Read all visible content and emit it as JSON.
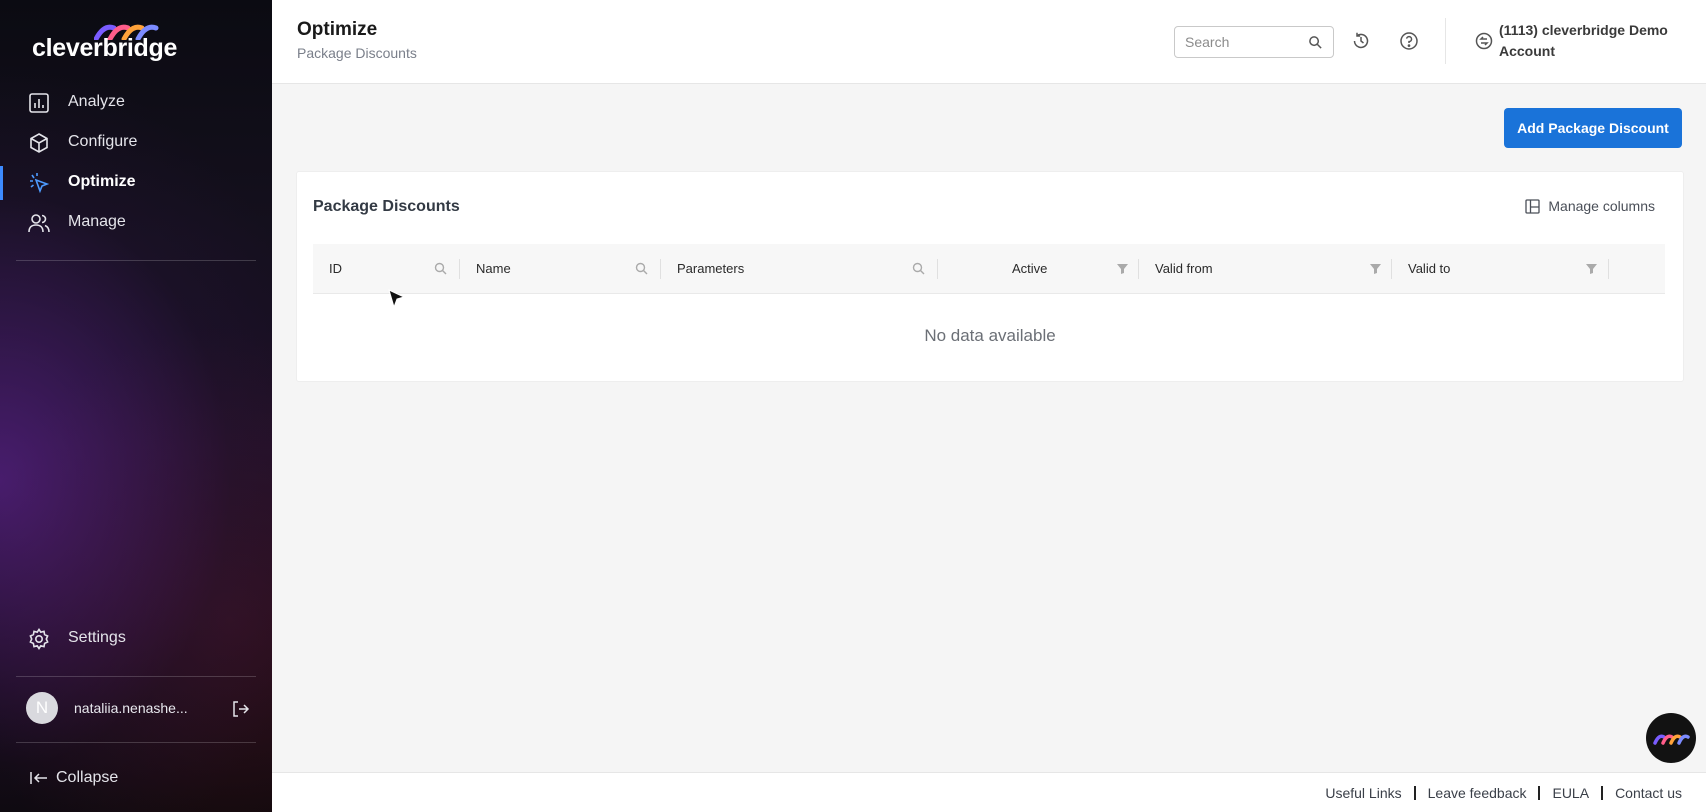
{
  "brand": {
    "name": "cleverbridge"
  },
  "sidebar": {
    "items": [
      {
        "label": "Analyze",
        "icon": "bar-chart-icon"
      },
      {
        "label": "Configure",
        "icon": "cube-icon"
      },
      {
        "label": "Optimize",
        "icon": "cursor-click-icon",
        "active": true
      },
      {
        "label": "Manage",
        "icon": "users-icon"
      }
    ],
    "settings_label": "Settings",
    "user": {
      "initial": "N",
      "name": "nataliia.nenashe..."
    },
    "collapse_label": "Collapse"
  },
  "header": {
    "title": "Optimize",
    "subtitle": "Package Discounts",
    "search_placeholder": "Search",
    "account": "(1113) cleverbridge Demo Account"
  },
  "main": {
    "add_button": "Add Package Discount",
    "card_title": "Package Discounts",
    "manage_columns": "Manage columns",
    "columns": [
      {
        "label": "ID",
        "control": "search-icon"
      },
      {
        "label": "Name",
        "control": "search-icon"
      },
      {
        "label": "Parameters",
        "control": "search-icon"
      },
      {
        "label": "Active",
        "control": "filter-icon"
      },
      {
        "label": "Valid from",
        "control": "filter-icon"
      },
      {
        "label": "Valid to",
        "control": "filter-icon"
      }
    ],
    "empty_text": "No data available"
  },
  "footer": {
    "links": [
      "Useful Links",
      "Leave feedback",
      "EULA",
      "Contact us"
    ]
  },
  "colors": {
    "accent": "#1a73d9",
    "active_indicator": "#3d8bff",
    "sidebar_bg": "#0b0b12"
  }
}
